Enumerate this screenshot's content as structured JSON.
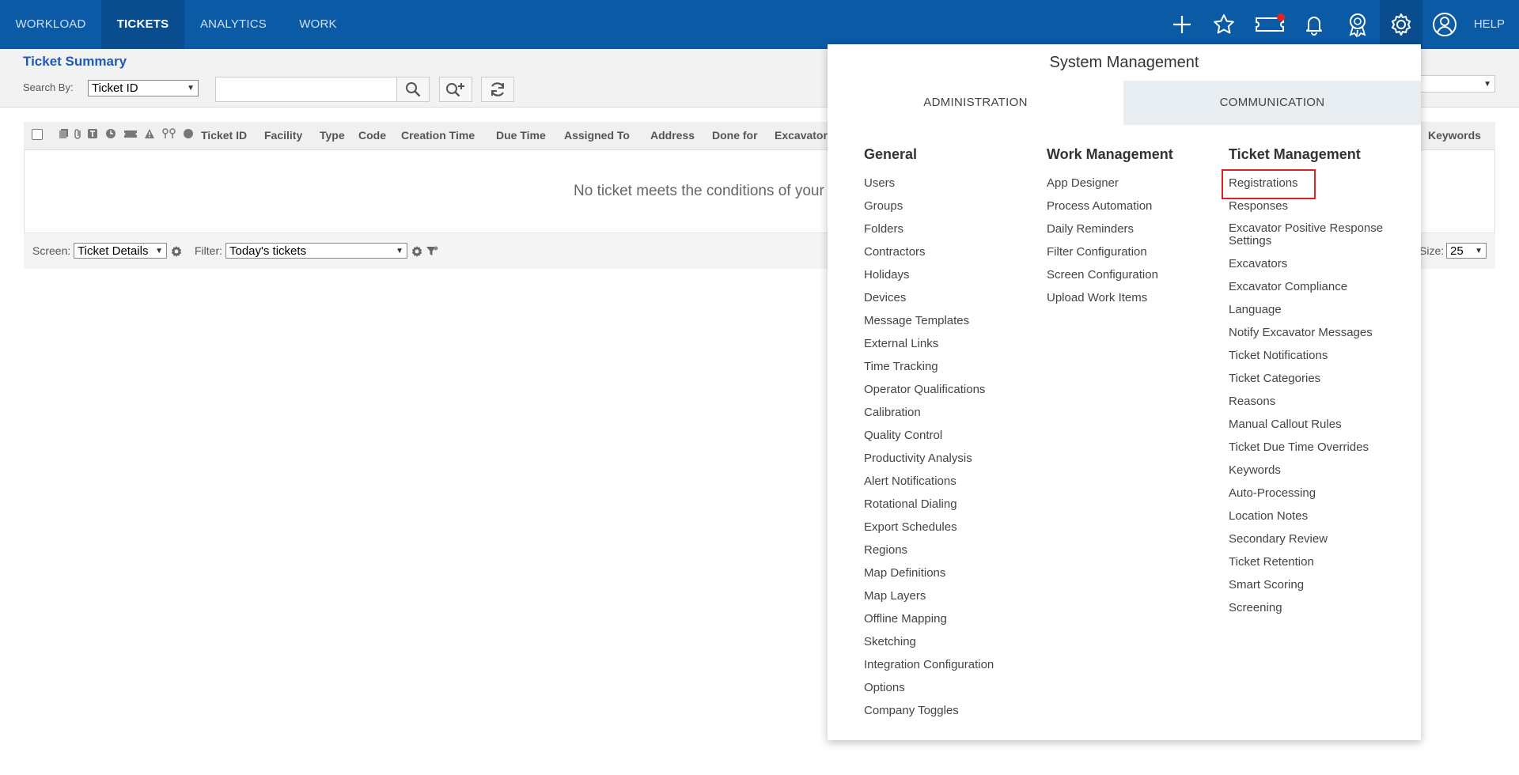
{
  "topnav": {
    "tabs": [
      {
        "label": "WORKLOAD"
      },
      {
        "label": "TICKETS"
      },
      {
        "label": "ANALYTICS"
      },
      {
        "label": "WORK"
      }
    ],
    "help_label": "HELP",
    "icons": [
      "plus-icon",
      "star-icon",
      "ticket-icon",
      "bell-icon",
      "award-icon",
      "gear-icon",
      "user-icon"
    ]
  },
  "summary": {
    "title": "Ticket Summary",
    "search_by_label": "Search By:",
    "search_by_value": "Ticket ID"
  },
  "grid": {
    "columns": [
      "Ticket ID",
      "Facility",
      "Type",
      "Code",
      "Creation Time",
      "Due Time",
      "Assigned To",
      "Address",
      "Done for",
      "Excavator",
      "Keywords"
    ],
    "empty_message": "No ticket meets the conditions of your filter",
    "screen_label": "Screen:",
    "screen_value": "Ticket Details",
    "filter_label": "Filter:",
    "filter_value": "Today's tickets",
    "size_label": "Size:",
    "size_value": "25"
  },
  "panel": {
    "title": "System Management",
    "tabs": [
      {
        "label": "ADMINISTRATION"
      },
      {
        "label": "COMMUNICATION"
      }
    ],
    "columns": [
      {
        "heading": "General",
        "items": [
          "Users",
          "Groups",
          "Folders",
          "Contractors",
          "Holidays",
          "Devices",
          "Message Templates",
          "External Links",
          "Time Tracking",
          "Operator Qualifications",
          "Calibration",
          "Quality Control",
          "Productivity Analysis",
          "Alert Notifications",
          "Rotational Dialing",
          "Export Schedules",
          "Regions",
          "Map Definitions",
          "Map Layers",
          "Offline Mapping",
          "Sketching",
          "Integration Configuration",
          "Options",
          "Company Toggles"
        ]
      },
      {
        "heading": "Work Management",
        "items": [
          "App Designer",
          "Process Automation",
          "Daily Reminders",
          "Filter Configuration",
          "Screen Configuration",
          "Upload Work Items"
        ]
      },
      {
        "heading": "Ticket Management",
        "items": [
          "Registrations",
          "Responses",
          "Excavator Positive Response Settings",
          "Excavators",
          "Excavator Compliance",
          "Language",
          "Notify Excavator Messages",
          "Ticket Notifications",
          "Ticket Categories",
          "Reasons",
          "Manual Callout Rules",
          "Ticket Due Time Overrides",
          "Keywords",
          "Auto-Processing",
          "Location Notes",
          "Secondary Review",
          "Ticket Retention",
          "Smart Scoring",
          "Screening"
        ]
      }
    ]
  },
  "colors": {
    "nav_bg": "#0b5aa6",
    "nav_active": "#0a4d8f",
    "title_blue": "#1e5ab8",
    "highlight_red": "#e02020"
  }
}
